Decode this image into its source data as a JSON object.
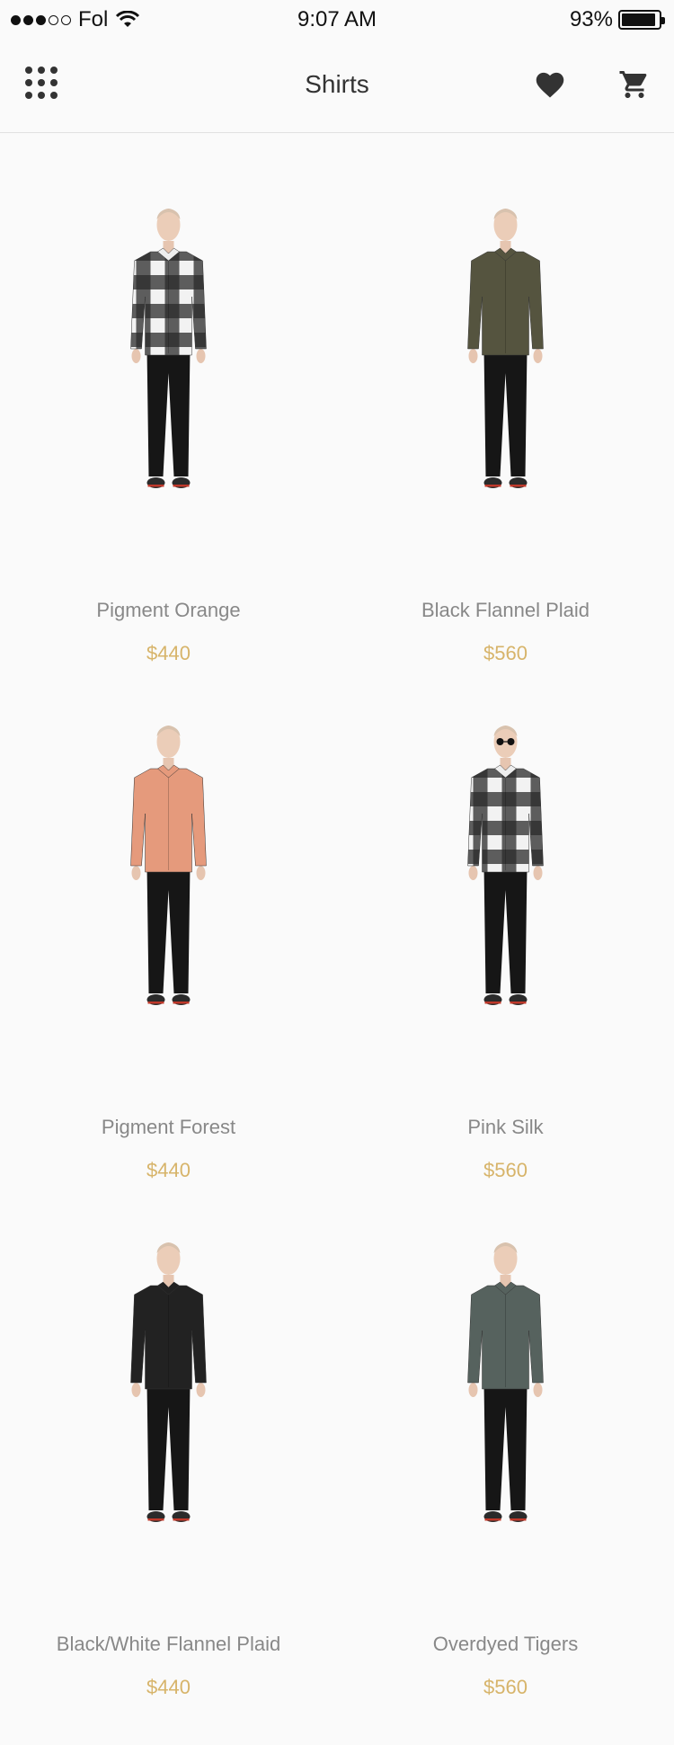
{
  "status_bar": {
    "carrier": "Fol",
    "time": "9:07 AM",
    "battery_percent": "93%",
    "battery_level": 0.93,
    "signal_full": 3,
    "signal_total": 5
  },
  "nav": {
    "title": "Shirts",
    "menu_icon": "grid-dots-icon",
    "favorite_icon": "heart-icon",
    "cart_icon": "cart-icon"
  },
  "products": [
    {
      "name": "Pigment Orange",
      "price": "$440",
      "shirt": "plaid-bw",
      "glasses": false
    },
    {
      "name": "Black Flannel Plaid",
      "price": "$560",
      "shirt": "olive",
      "glasses": false
    },
    {
      "name": "Pigment Forest",
      "price": "$440",
      "shirt": "salmon",
      "glasses": false
    },
    {
      "name": "Pink Silk",
      "price": "$560",
      "shirt": "plaid-bw-pockets",
      "glasses": true
    },
    {
      "name": "Black/White Flannel Plaid",
      "price": "$440",
      "shirt": "black",
      "glasses": false
    },
    {
      "name": "Overdyed Tigers",
      "price": "$560",
      "shirt": "slate",
      "glasses": false
    }
  ],
  "colors": {
    "price": "#d7b46a",
    "name": "#888888",
    "background": "#fafafa",
    "divider": "#e1e1e1"
  }
}
